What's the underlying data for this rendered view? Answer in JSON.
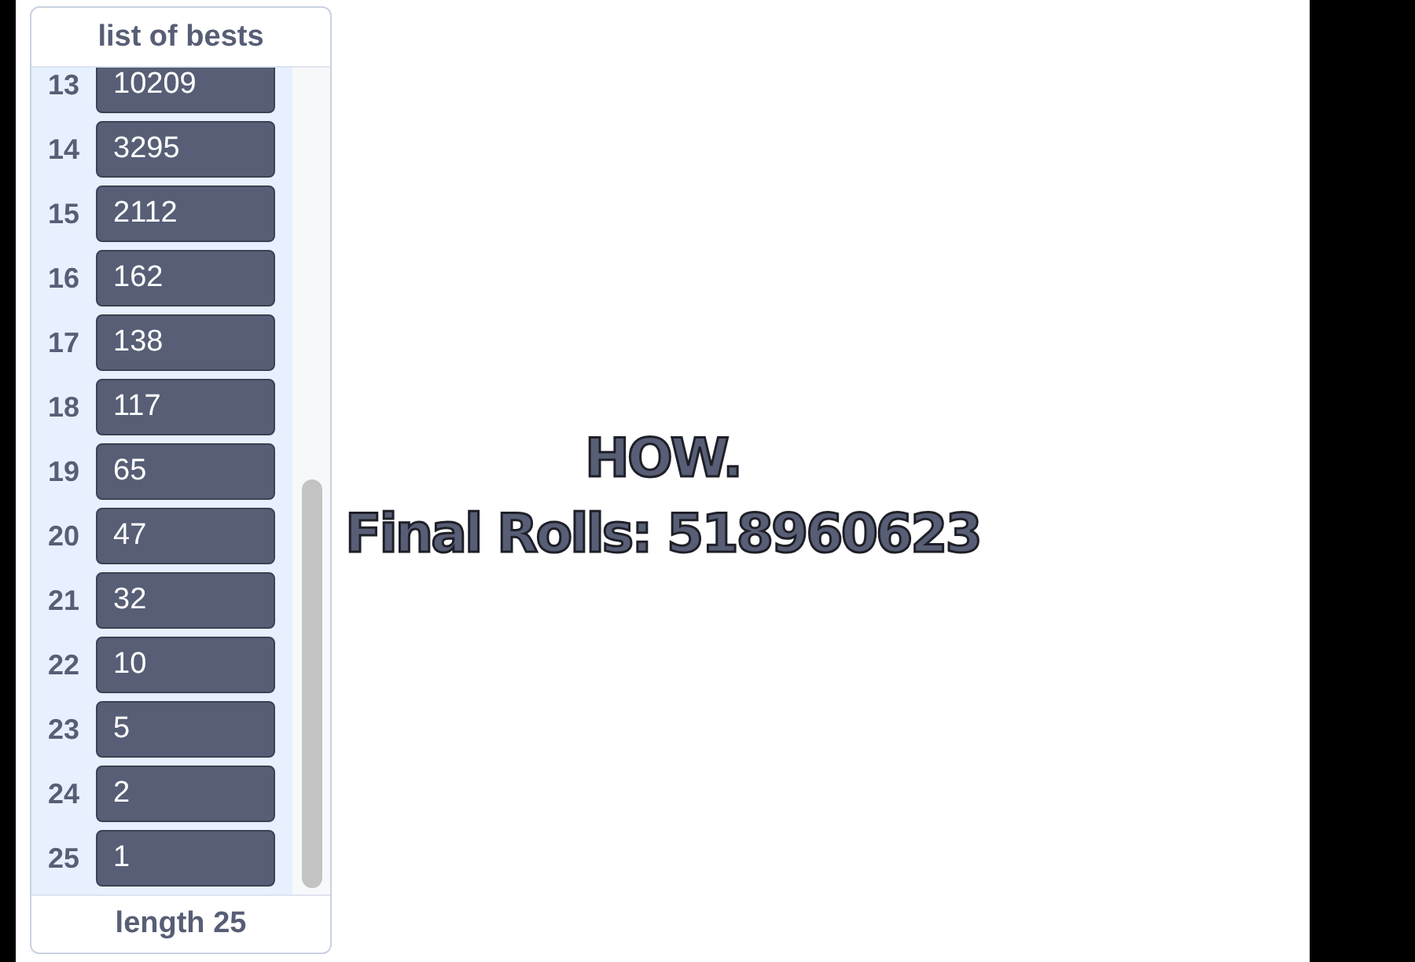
{
  "monitor": {
    "title": "list of bests",
    "items": [
      {
        "index": "13",
        "value": "10209"
      },
      {
        "index": "14",
        "value": "3295"
      },
      {
        "index": "15",
        "value": "2112"
      },
      {
        "index": "16",
        "value": "162"
      },
      {
        "index": "17",
        "value": "138"
      },
      {
        "index": "18",
        "value": "117"
      },
      {
        "index": "19",
        "value": "65"
      },
      {
        "index": "20",
        "value": "47"
      },
      {
        "index": "21",
        "value": "32"
      },
      {
        "index": "22",
        "value": "10"
      },
      {
        "index": "23",
        "value": "5"
      },
      {
        "index": "24",
        "value": "2"
      },
      {
        "index": "25",
        "value": "1"
      }
    ],
    "footer": "length 25"
  },
  "stage_text": {
    "lines": [
      "HOW.",
      "Final Rolls: 518960623"
    ]
  }
}
